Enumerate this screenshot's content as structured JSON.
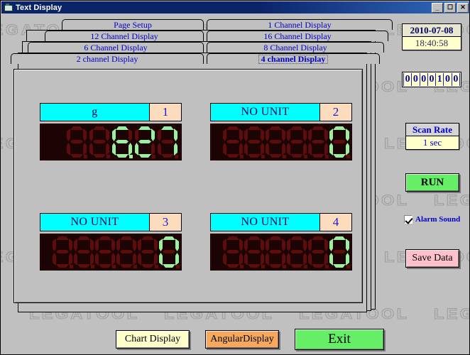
{
  "window": {
    "title": "Text Display",
    "icon": "app-icon",
    "buttons": {
      "minimize": "_",
      "maximize": "☐",
      "close": "✕"
    }
  },
  "watermark": {
    "text": "LEGATOOL"
  },
  "tabs": [
    {
      "label": "Page Setup",
      "selected": false,
      "row": 0,
      "col": 0
    },
    {
      "label": "1 Channel Display",
      "selected": false,
      "row": 0,
      "col": 1
    },
    {
      "label": "12 Channel Display",
      "selected": false,
      "row": 1,
      "col": 0
    },
    {
      "label": "16 Channel Display",
      "selected": false,
      "row": 1,
      "col": 1
    },
    {
      "label": "6 Channel Display",
      "selected": false,
      "row": 2,
      "col": 0
    },
    {
      "label": "8 Channel Display",
      "selected": false,
      "row": 2,
      "col": 1
    },
    {
      "label": "2 channel Display",
      "selected": false,
      "row": 3,
      "col": 0
    },
    {
      "label": "4 channel Display",
      "selected": true,
      "row": 3,
      "col": 1
    }
  ],
  "channels": [
    {
      "number": "1",
      "unit": "g",
      "value": "  6.27",
      "digits": 5
    },
    {
      "number": "2",
      "unit": "NO UNIT",
      "value": "     0",
      "digits": 6
    },
    {
      "number": "3",
      "unit": "NO UNIT",
      "value": "     0",
      "digits": 6
    },
    {
      "number": "4",
      "unit": "NO UNIT",
      "value": "     0",
      "digits": 6
    }
  ],
  "sidebar": {
    "date": "2010-07-08",
    "time": "18:40:58",
    "counter": "0000100",
    "scan_rate_label": "Scan Rate",
    "scan_rate_value": "1 sec",
    "run_label": "RUN",
    "alarm_sound_label": "Alarm Sound",
    "alarm_sound_checked": true,
    "save_data_label": "Save Data"
  },
  "footer": {
    "chart_label": "Chart Display",
    "angular_label": "AngularDisplay",
    "exit_label": "Exit"
  },
  "colors": {
    "face": "#c0c0c0",
    "title_bar": "#0a246a",
    "tab_text": "#0000c8",
    "unit_bg": "#00ffff",
    "num_bg": "#fbdcbd",
    "lcd_bg": "#1c0404",
    "seg_off": "#5e0d0d",
    "seg_on": "#9cf09c",
    "run_green": "#66ee66",
    "save_pink": "#ffc0cb",
    "angular_orange": "#f5a85e",
    "chart_yellow": "#ffffcc"
  }
}
